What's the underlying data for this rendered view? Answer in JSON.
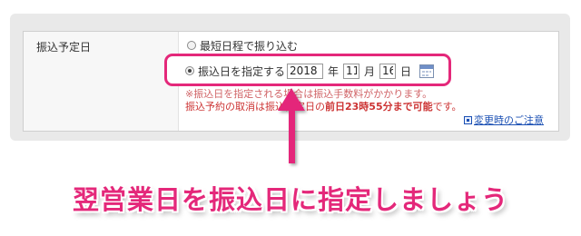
{
  "form": {
    "field_label": "振込予定日",
    "option_shortest": "最短日程で振り込む",
    "option_specify": "振込日を指定する",
    "year_value": "2018",
    "year_unit": "年",
    "month_value": "11",
    "month_unit": "月",
    "day_value": "16",
    "day_unit": "日",
    "note_line1": "※振込日を指定される場合は振込手数料がかかります。",
    "note_line2_prefix": "振込予約の取消は振込指定日の",
    "note_line2_bold": "前日23時55分まで可能",
    "note_line2_suffix": "です。",
    "link_label": "変更時のご注意"
  },
  "annotation": {
    "caption": "翌営業日を振込日に指定しましょう",
    "accent_color": "#e4287a"
  },
  "icons": {
    "calendar": "calendar-icon",
    "link": "info-window-icon",
    "arrow": "up-arrow"
  }
}
